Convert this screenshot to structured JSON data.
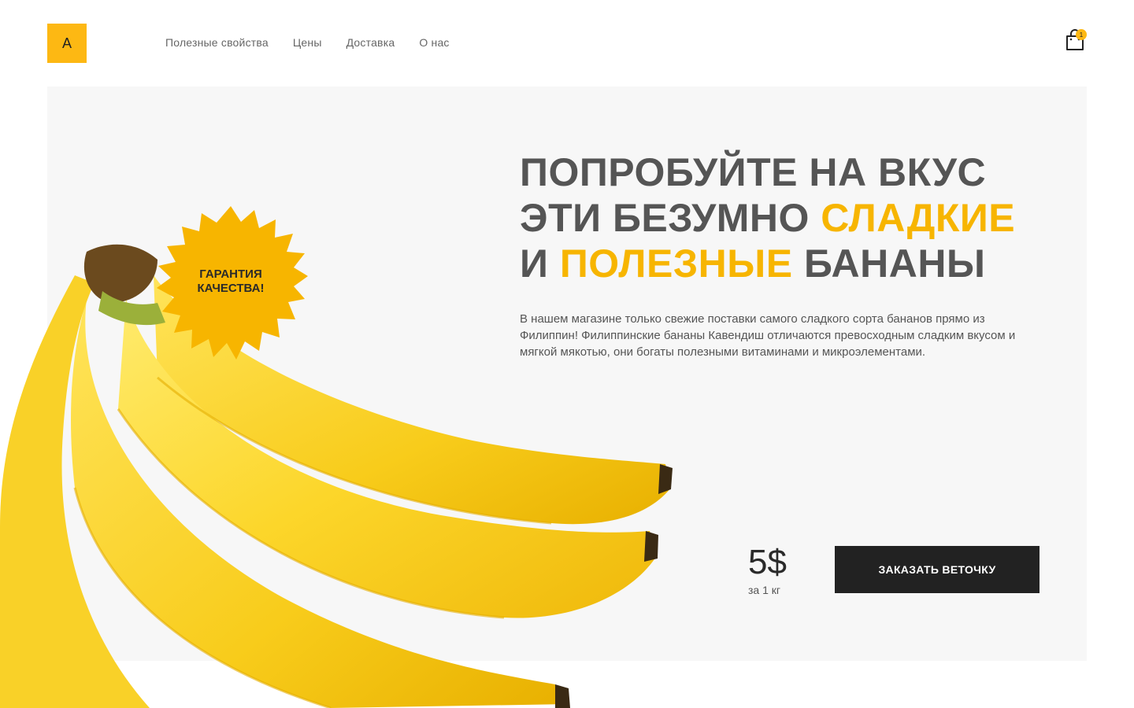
{
  "header": {
    "logo_letter": "A",
    "nav": [
      "Полезные свойства",
      "Цены",
      "Доставка",
      "О нас"
    ],
    "cart_count": "1"
  },
  "hero": {
    "headline": {
      "line1": "Попробуйте на вкус",
      "line2_a": "эти безумно ",
      "line2_b": "сладкие",
      "line3_a": "и ",
      "line3_b": "полезные",
      "line3_c": " бананы"
    },
    "description": "В нашем магазине только свежие поставки самого сладкого сорта бананов прямо из Филиппин! Филиппинские бананы Кавендиш отличаются превосходным сладким вкусом и мягкой мякотью, они богаты полезными витаминами и микроэлементами.",
    "badge": {
      "line1": "Гарантия",
      "line2": "качества!"
    },
    "price": "5$",
    "price_unit": "за 1 кг",
    "order_button": "Заказать веточку"
  },
  "colors": {
    "accent": "#F7B500",
    "dark": "#222222",
    "text": "#555555",
    "hero_bg": "#F7F7F7"
  },
  "icons": [
    "shopping-bag-icon",
    "banana-image",
    "starburst-badge"
  ]
}
